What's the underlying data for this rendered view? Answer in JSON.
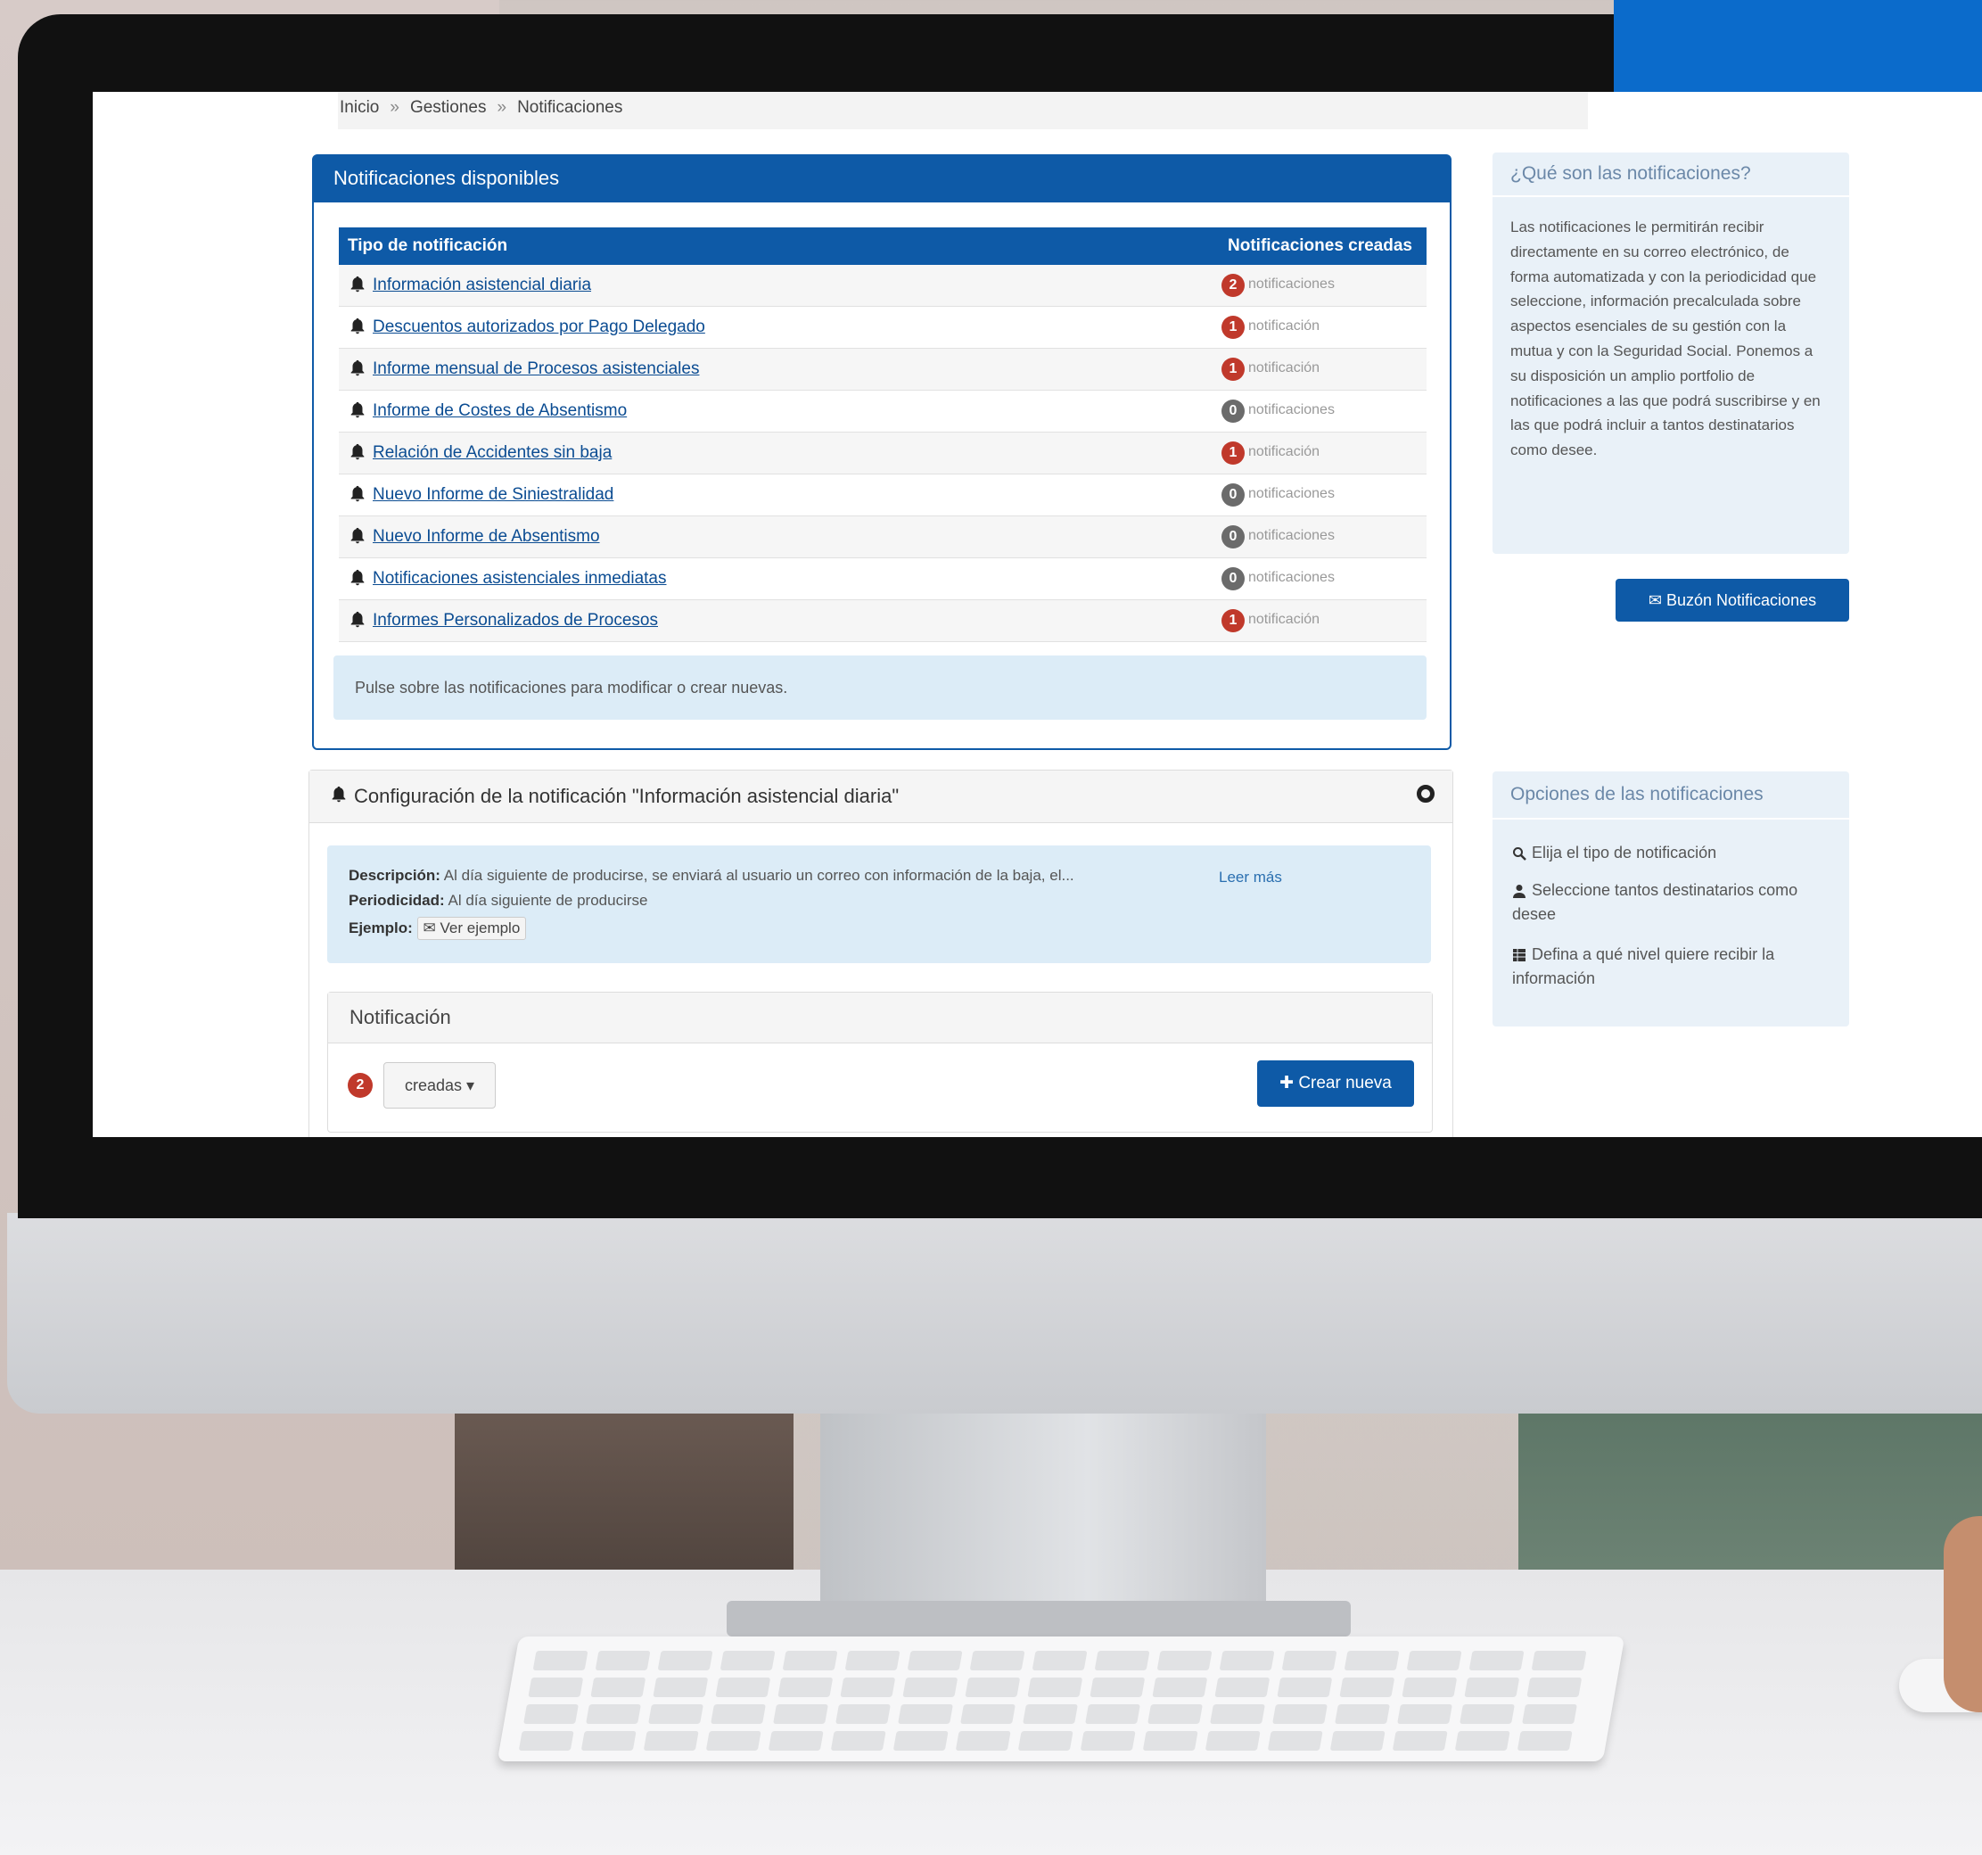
{
  "colors": {
    "primary": "#0e5aa7",
    "badge_red": "#c0392b",
    "badge_gray": "#6b6b6b",
    "info_bg": "#dcecf7"
  },
  "breadcrumb": [
    "Inicio",
    "Gestiones",
    "Notificaciones"
  ],
  "available": {
    "title": "Notificaciones disponibles",
    "columns": {
      "type": "Tipo de notificación",
      "created": "Notificaciones creadas"
    },
    "rows": [
      {
        "name": "Información asistencial diaria",
        "count": "2",
        "unit": "notificaciones",
        "status": "red"
      },
      {
        "name": "Descuentos autorizados por Pago Delegado",
        "count": "1",
        "unit": "notificación",
        "status": "red"
      },
      {
        "name": "Informe mensual de Procesos asistenciales",
        "count": "1",
        "unit": "notificación",
        "status": "red"
      },
      {
        "name": "Informe de Costes de Absentismo",
        "count": "0",
        "unit": "notificaciones",
        "status": "gray"
      },
      {
        "name": "Relación de Accidentes sin baja",
        "count": "1",
        "unit": "notificación",
        "status": "red"
      },
      {
        "name": "Nuevo Informe de Siniestralidad",
        "count": "0",
        "unit": "notificaciones",
        "status": "gray"
      },
      {
        "name": "Nuevo Informe de Absentismo",
        "count": "0",
        "unit": "notificaciones",
        "status": "gray"
      },
      {
        "name": "Notificaciones asistenciales inmediatas",
        "count": "0",
        "unit": "notificaciones",
        "status": "gray"
      },
      {
        "name": "Informes Personalizados de Procesos",
        "count": "1",
        "unit": "notificación",
        "status": "red"
      }
    ],
    "hint": "Pulse sobre las notificaciones para modificar o crear nuevas."
  },
  "config": {
    "title": "Configuración de la notificación \"Información asistencial diaria\"",
    "desc_label": "Descripción:",
    "desc_text": "Al día siguiente de producirse, se enviará al usuario un correo con información de la baja, el...",
    "read_more": "Leer más",
    "period_label": "Periodicidad:",
    "period_text": "Al día siguiente de producirse",
    "example_label": "Ejemplo:",
    "example_button": "Ver ejemplo",
    "notification_header": "Notificación",
    "created_count": "2",
    "created_dropdown": "creadas ▾",
    "create_button": "Crear nueva"
  },
  "what": {
    "title": "¿Qué son las notificaciones?",
    "body": "Las notificaciones le permitirán recibir directamente en su correo electrónico, de forma automatizada y con la periodicidad que seleccione, información precalculada sobre aspectos esenciales de su gestión con la mutua y con la Seguridad Social. Ponemos a su disposición un amplio portfolio de notificaciones a las que podrá suscribirse y en las que podrá incluir a tantos destinatarios como desee."
  },
  "inbox_button": "Buzón Notificaciones",
  "options": {
    "title": "Opciones de las notificaciones",
    "items": [
      {
        "icon": "search-icon",
        "text": "Elija el tipo de notificación"
      },
      {
        "icon": "user-icon",
        "text": "Seleccione tantos destinatarios como desee"
      },
      {
        "icon": "table-icon",
        "text": "Defina a qué nivel quiere recibir la información"
      }
    ]
  }
}
